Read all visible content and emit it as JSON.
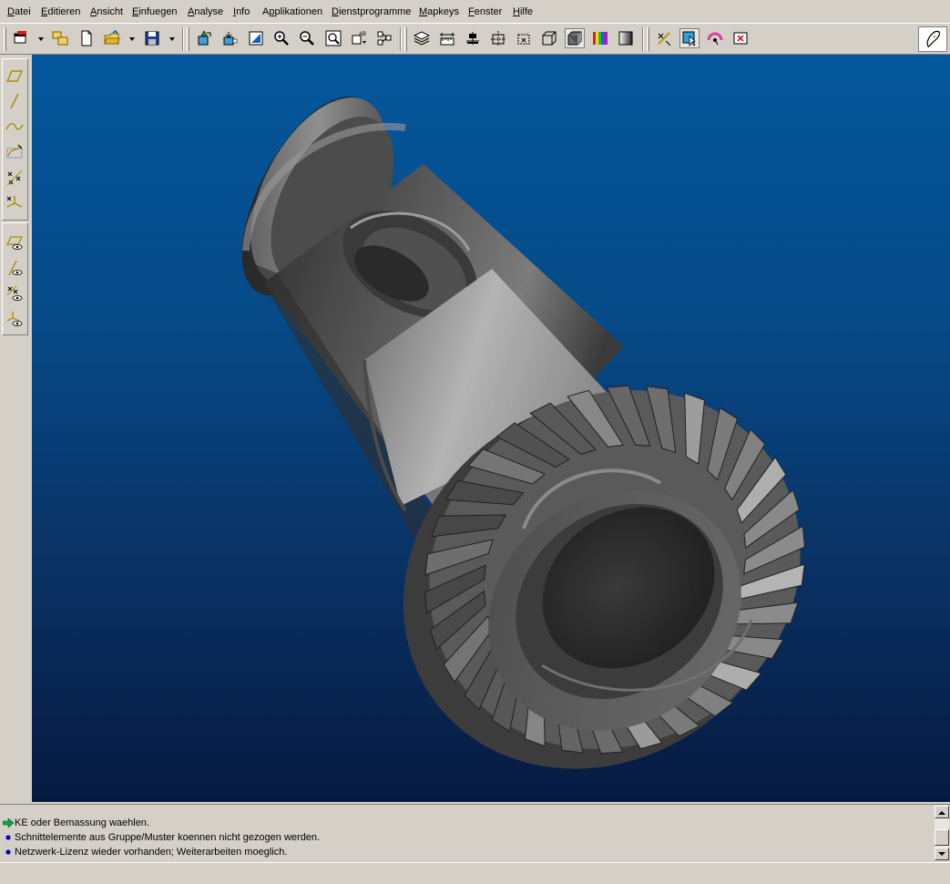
{
  "menu": {
    "items": [
      {
        "label": "Datei",
        "underline": "D"
      },
      {
        "label": "Editieren",
        "underline": "E"
      },
      {
        "label": "Ansicht",
        "underline": "A"
      },
      {
        "label": "Einfuegen",
        "underline": "E"
      },
      {
        "label": "Analyse",
        "underline": "A"
      },
      {
        "label": "Info",
        "underline": "I"
      },
      {
        "label": "Applikationen",
        "underline": "p"
      },
      {
        "label": "Dienstprogramme",
        "underline": "D"
      },
      {
        "label": "Mapkeys",
        "underline": "M"
      },
      {
        "label": "Fenster",
        "underline": "F"
      },
      {
        "label": "Hilfe",
        "underline": "H"
      }
    ]
  },
  "viewport": {
    "background_top": "#04579c",
    "background_bottom": "#061a40",
    "model": "bevel-gear-shaft"
  },
  "messages": [
    {
      "icon": "green-arrow-icon",
      "text": "KE oder Bemassung waehlen."
    },
    {
      "icon": "blue-dot-icon",
      "text": "Schnittelemente aus Gruppe/Muster koennen nicht gezogen werden."
    },
    {
      "icon": "blue-dot-icon",
      "text": "Netzwerk-Lizenz wieder vorhanden; Weiterarbeiten moeglich."
    }
  ],
  "colors": {
    "chrome": "#d4d0c8",
    "message_dot": "#0000cc",
    "message_arrow": "#00aa44",
    "datum_yellow": "#b8a000"
  }
}
